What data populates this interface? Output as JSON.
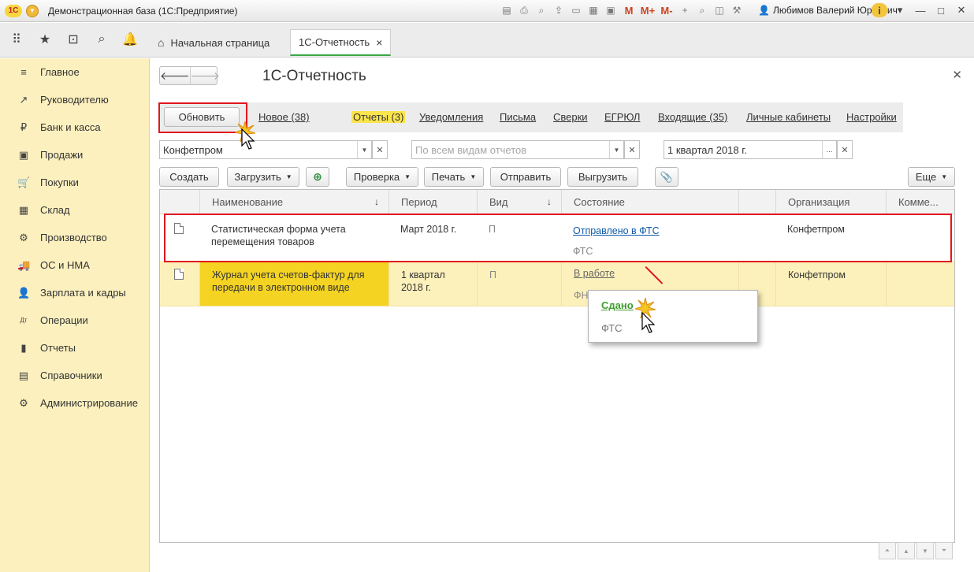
{
  "window": {
    "app_badge": "1С",
    "title": "Демонстрационная база  (1С:Предприятие)",
    "user": "Любимов Валерий Юрьевич",
    "tool_icons": [
      "save-icon",
      "print-icon",
      "preview-icon",
      "upload-icon",
      "print-icon",
      "calendar-grid-icon",
      "calendar-icon",
      "M",
      "M+",
      "M-",
      "plus-icon",
      "zoom-icon",
      "panels-icon",
      "settings-icon"
    ]
  },
  "tabs": {
    "home": "Начальная страница",
    "active": "1С-Отчетность",
    "close": "×"
  },
  "sidebar": {
    "items": [
      {
        "label": "Главное",
        "icon": "≡"
      },
      {
        "label": "Руководителю",
        "icon": "↗"
      },
      {
        "label": "Банк и касса",
        "icon": "₽"
      },
      {
        "label": "Продажи",
        "icon": "▣"
      },
      {
        "label": "Покупки",
        "icon": "🛒"
      },
      {
        "label": "Склад",
        "icon": "▦"
      },
      {
        "label": "Производство",
        "icon": "⚙"
      },
      {
        "label": "ОС и НМА",
        "icon": "🚚"
      },
      {
        "label": "Зарплата и кадры",
        "icon": "👤"
      },
      {
        "label": "Операции",
        "icon": "Дт"
      },
      {
        "label": "Отчеты",
        "icon": "▮"
      },
      {
        "label": "Справочники",
        "icon": "▤"
      },
      {
        "label": "Администрирование",
        "icon": "⚙"
      }
    ]
  },
  "main": {
    "title": "1С-Отчетность",
    "refresh": "Обновить",
    "links": [
      "Новое (38)",
      "Отчеты (3)",
      "Уведомления",
      "Письма",
      "Сверки",
      "ЕГРЮЛ",
      "Входящие (35)",
      "Личные кабинеты",
      "Настройки"
    ],
    "filters": {
      "org": "Конфетпром",
      "kinds_placeholder": "По всем видам отчетов",
      "period": "1 квартал 2018 г."
    },
    "toolbar": {
      "create": "Создать",
      "load": "Загрузить",
      "check": "Проверка",
      "print": "Печать",
      "send": "Отправить",
      "export": "Выгрузить",
      "more": "Еще"
    },
    "columns": [
      "Наименование",
      "Период",
      "Вид",
      "Состояние",
      "Организация",
      "Комме..."
    ],
    "rows": [
      {
        "name": "Статистическая форма учета перемещения товаров",
        "period": "Март 2018 г.",
        "kind": "П",
        "status": "Отправлено в ФТС",
        "status_sub": "ФТС",
        "org": "Конфетпром"
      },
      {
        "name": "Журнал учета счетов-фактур для передачи в электронном виде",
        "period": "1 квартал 2018 г.",
        "kind": "П",
        "status": "В работе",
        "status_sub": "ФН",
        "org": "Конфетпром"
      }
    ],
    "popup": {
      "accepted": "Сдано",
      "agency": "ФТС"
    }
  },
  "colors": {
    "sidebar_bg": "#fcf0bf",
    "highlight": "#fbe44c",
    "selected_cell": "#f5d322",
    "red_frame": "#e0161d",
    "link_blue": "#0f5aa8",
    "green": "#3f9d2f"
  }
}
